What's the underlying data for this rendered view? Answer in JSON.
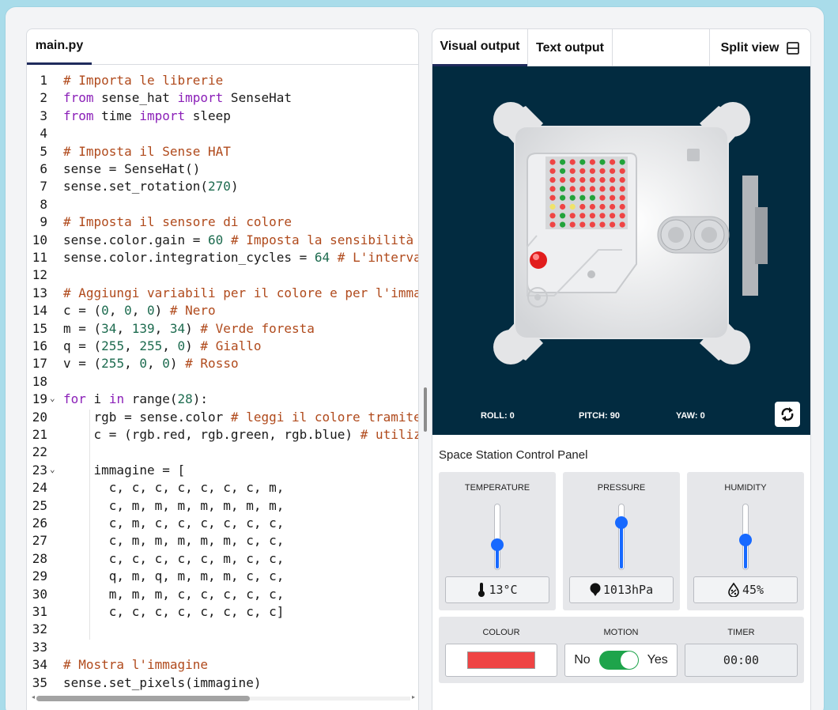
{
  "editor": {
    "tab_label": "main.py",
    "lines": [
      {
        "n": "1",
        "parts": [
          [
            "cm",
            "# Importa le librerie"
          ]
        ]
      },
      {
        "n": "2",
        "parts": [
          [
            "kw",
            "from"
          ],
          [
            "",
            " sense_hat "
          ],
          [
            "kw",
            "import"
          ],
          [
            "",
            " SenseHat"
          ]
        ]
      },
      {
        "n": "3",
        "parts": [
          [
            "kw",
            "from"
          ],
          [
            "",
            " time "
          ],
          [
            "kw",
            "import"
          ],
          [
            "",
            " sleep"
          ]
        ]
      },
      {
        "n": "4",
        "parts": []
      },
      {
        "n": "5",
        "parts": [
          [
            "cm",
            "# Imposta il Sense HAT"
          ]
        ]
      },
      {
        "n": "6",
        "parts": [
          [
            "",
            "sense = SenseHat()"
          ]
        ]
      },
      {
        "n": "7",
        "parts": [
          [
            "",
            "sense.set_rotation("
          ],
          [
            "num",
            "270"
          ],
          [
            "",
            ")"
          ]
        ]
      },
      {
        "n": "8",
        "parts": []
      },
      {
        "n": "9",
        "parts": [
          [
            "cm",
            "# Imposta il sensore di colore"
          ]
        ]
      },
      {
        "n": "10",
        "parts": [
          [
            "",
            "sense.color.gain = "
          ],
          [
            "num",
            "60"
          ],
          [
            "",
            " "
          ],
          [
            "cm",
            "# Imposta la sensibilità"
          ]
        ]
      },
      {
        "n": "11",
        "parts": [
          [
            "",
            "sense.color.integration_cycles = "
          ],
          [
            "num",
            "64"
          ],
          [
            "",
            " "
          ],
          [
            "cm",
            "# L'interva"
          ]
        ]
      },
      {
        "n": "12",
        "parts": []
      },
      {
        "n": "13",
        "parts": [
          [
            "cm",
            "# Aggiungi variabili per il colore e per l'imma"
          ]
        ]
      },
      {
        "n": "14",
        "parts": [
          [
            "",
            "c = ("
          ],
          [
            "num",
            "0"
          ],
          [
            "",
            ", "
          ],
          [
            "num",
            "0"
          ],
          [
            "",
            ", "
          ],
          [
            "num",
            "0"
          ],
          [
            "",
            ") "
          ],
          [
            "cm",
            "# Nero"
          ]
        ]
      },
      {
        "n": "15",
        "parts": [
          [
            "",
            "m = ("
          ],
          [
            "num",
            "34"
          ],
          [
            "",
            ", "
          ],
          [
            "num",
            "139"
          ],
          [
            "",
            ", "
          ],
          [
            "num",
            "34"
          ],
          [
            "",
            ") "
          ],
          [
            "cm",
            "# Verde foresta"
          ]
        ]
      },
      {
        "n": "16",
        "parts": [
          [
            "",
            "q = ("
          ],
          [
            "num",
            "255"
          ],
          [
            "",
            ", "
          ],
          [
            "num",
            "255"
          ],
          [
            "",
            ", "
          ],
          [
            "num",
            "0"
          ],
          [
            "",
            ") "
          ],
          [
            "cm",
            "# Giallo"
          ]
        ]
      },
      {
        "n": "17",
        "parts": [
          [
            "",
            "v = ("
          ],
          [
            "num",
            "255"
          ],
          [
            "",
            ", "
          ],
          [
            "num",
            "0"
          ],
          [
            "",
            ", "
          ],
          [
            "num",
            "0"
          ],
          [
            "",
            ") "
          ],
          [
            "cm",
            "# Rosso"
          ]
        ]
      },
      {
        "n": "18",
        "parts": []
      },
      {
        "n": "19",
        "fold": true,
        "parts": [
          [
            "kw",
            "for"
          ],
          [
            "",
            " i "
          ],
          [
            "kw",
            "in"
          ],
          [
            "",
            " range("
          ],
          [
            "num",
            "28"
          ],
          [
            "",
            "):"
          ]
        ]
      },
      {
        "n": "20",
        "parts": [
          [
            "",
            "    rgb = sense.color "
          ],
          [
            "cm",
            "# leggi il colore tramite"
          ]
        ]
      },
      {
        "n": "21",
        "parts": [
          [
            "",
            "    c = (rgb.red, rgb.green, rgb.blue) "
          ],
          [
            "cm",
            "# utiliz"
          ]
        ]
      },
      {
        "n": "22",
        "parts": []
      },
      {
        "n": "23",
        "fold": true,
        "parts": [
          [
            "",
            "    immagine = ["
          ]
        ]
      },
      {
        "n": "24",
        "parts": [
          [
            "",
            "      c, c, c, c, c, c, c, m,"
          ]
        ]
      },
      {
        "n": "25",
        "parts": [
          [
            "",
            "      c, m, m, m, m, m, m, m,"
          ]
        ]
      },
      {
        "n": "26",
        "parts": [
          [
            "",
            "      c, m, c, c, c, c, c, c,"
          ]
        ]
      },
      {
        "n": "27",
        "parts": [
          [
            "",
            "      c, m, m, m, m, m, c, c,"
          ]
        ]
      },
      {
        "n": "28",
        "parts": [
          [
            "",
            "      c, c, c, c, c, m, c, c,"
          ]
        ]
      },
      {
        "n": "29",
        "parts": [
          [
            "",
            "      q, m, q, m, m, m, c, c,"
          ]
        ]
      },
      {
        "n": "30",
        "parts": [
          [
            "",
            "      m, m, m, c, c, c, c, c,"
          ]
        ]
      },
      {
        "n": "31",
        "parts": [
          [
            "",
            "      c, c, c, c, c, c, c, c]"
          ]
        ]
      },
      {
        "n": "32",
        "parts": []
      },
      {
        "n": "33",
        "parts": []
      },
      {
        "n": "34",
        "parts": [
          [
            "cm",
            "# Mostra l'immagine"
          ]
        ]
      },
      {
        "n": "35",
        "parts": [
          [
            "",
            "sense.set_pixels(immagine)"
          ]
        ]
      }
    ]
  },
  "output": {
    "tabs": [
      "Visual output",
      "Text output"
    ],
    "split_view_label": "Split view",
    "roll_label": "ROLL: 0",
    "pitch_label": "PITCH: 90",
    "yaw_label": "YAW: 0",
    "led_matrix": [
      "vmvmvmvm",
      "vmvvvvvv",
      "vvvvvvvv",
      "vmvvvvvv",
      "vmmmmvvv",
      "qvqvvvvv",
      "vmvvvvvv",
      "vmvvvvvv"
    ],
    "led_colors": {
      "v": "#ef4444",
      "m": "#22a33a",
      "q": "#f0e36b"
    }
  },
  "control_panel": {
    "title": "Space Station Control Panel",
    "temperature": {
      "label": "TEMPERATURE",
      "value": "13°C",
      "level": 0.38
    },
    "pressure": {
      "label": "PRESSURE",
      "value": "1013hPa",
      "level": 0.72
    },
    "humidity": {
      "label": "HUMIDITY",
      "value": "45%",
      "level": 0.45
    },
    "colour": {
      "label": "COLOUR",
      "swatch": "#ef4444"
    },
    "motion": {
      "label": "MOTION",
      "off_label": "No",
      "on_label": "Yes",
      "on": true
    },
    "timer": {
      "label": "TIMER",
      "value": "00:00"
    }
  },
  "colors": {
    "accent": "#1769ff",
    "stage_bg": "#022b40",
    "toggle_on": "#1ea44b"
  }
}
